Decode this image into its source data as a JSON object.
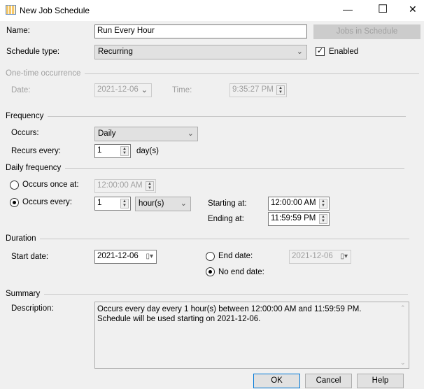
{
  "window": {
    "title": "New Job Schedule",
    "minimize": "—",
    "maximize": "☐",
    "close": "✕"
  },
  "name": {
    "label": "Name:",
    "value": "Run Every Hour",
    "jobs_button": "Jobs in Schedule"
  },
  "schedule_type": {
    "label": "Schedule type:",
    "value": "Recurring",
    "enabled_label": "Enabled",
    "enabled": true
  },
  "one_time": {
    "heading": "One-time occurrence",
    "date_label": "Date:",
    "date": "2021-12-06",
    "time_label": "Time:",
    "time": "9:35:27 PM"
  },
  "frequency": {
    "heading": "Frequency",
    "occurs_label": "Occurs:",
    "occurs": "Daily",
    "recurs_label": "Recurs every:",
    "recurs_value": "1",
    "recurs_unit": "day(s)"
  },
  "daily_frequency": {
    "heading": "Daily frequency",
    "once_label": "Occurs once at:",
    "once_time": "12:00:00 AM",
    "every_label": "Occurs every:",
    "every_value": "1",
    "every_unit": "hour(s)",
    "starting_label": "Starting at:",
    "starting": "12:00:00 AM",
    "ending_label": "Ending at:",
    "ending": "11:59:59 PM"
  },
  "duration": {
    "heading": "Duration",
    "start_label": "Start date:",
    "start": "2021-12-06",
    "end_label": "End date:",
    "end": "2021-12-06",
    "no_end_label": "No end date:"
  },
  "summary": {
    "heading": "Summary",
    "description_label": "Description:",
    "description": "Occurs every day every 1 hour(s) between 12:00:00 AM and 11:59:59 PM. Schedule will be used starting on 2021-12-06."
  },
  "buttons": {
    "ok": "OK",
    "cancel": "Cancel",
    "help": "Help"
  }
}
